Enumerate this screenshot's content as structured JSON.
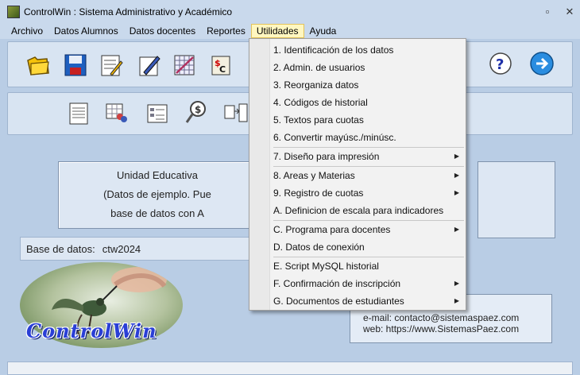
{
  "window": {
    "title": "ControlWin : Sistema Administrativo y Académico",
    "controls": {
      "minimize": "▫",
      "close": "✕"
    }
  },
  "menubar": {
    "items": [
      "Archivo",
      "Datos Alumnos",
      "Datos docentes",
      "Reportes",
      "Utilidades",
      "Ayuda"
    ],
    "active_index": 4
  },
  "info_box": {
    "line1": "Unidad Educativa",
    "line2": "(Datos de ejemplo. Pue",
    "line3": "base de datos con A"
  },
  "database": {
    "label": "Base de datos:",
    "value": "ctw2024"
  },
  "logo": {
    "text": "ControlWin"
  },
  "contact": {
    "email": "e-mail: contacto@sistemaspaez.com",
    "web": "web: https://www.SistemasPaez.com"
  },
  "dropdown": {
    "items": [
      {
        "label": "1. Identificación de los datos",
        "submenu": false
      },
      {
        "label": "2. Admin. de usuarios",
        "submenu": false
      },
      {
        "label": "3. Reorganiza datos",
        "submenu": false
      },
      {
        "label": "4. Códigos de historial",
        "submenu": false
      },
      {
        "label": "5. Textos para cuotas",
        "submenu": false
      },
      {
        "label": "6. Convertir mayúsc./minúsc.",
        "submenu": false
      },
      {
        "label": "7. Diseño para impresión",
        "submenu": true
      },
      {
        "label": "8. Areas y Materias",
        "submenu": true
      },
      {
        "label": "9. Registro de cuotas",
        "submenu": true
      },
      {
        "label": "A. Definicion de escala para indicadores",
        "submenu": false
      },
      {
        "label": "C. Programa para docentes",
        "submenu": true
      },
      {
        "label": "D. Datos de conexión",
        "submenu": false
      },
      {
        "label": "E. Script MySQL historial",
        "submenu": false
      },
      {
        "label": "F. Confirmación de inscripción",
        "submenu": true
      },
      {
        "label": "G. Documentos de estudiantes",
        "submenu": true
      }
    ],
    "submenu_arrow": "▶"
  },
  "icons": {
    "toolbar1": [
      "open-folder-icon",
      "save-disk-icon",
      "edit-document-icon",
      "pen-write-icon",
      "grid-schedule-icon",
      "dollar-c-icon",
      "help-icon",
      "next-arrow-icon"
    ],
    "toolbar2": [
      "document-list-icon",
      "users-grid-icon",
      "form-list-icon",
      "dollar-search-icon",
      "transfer-icon"
    ]
  },
  "colors": {
    "menu_active_bg": "#fff7c0",
    "logo_text": "#2a3fd6",
    "background": "#b9cde5"
  }
}
